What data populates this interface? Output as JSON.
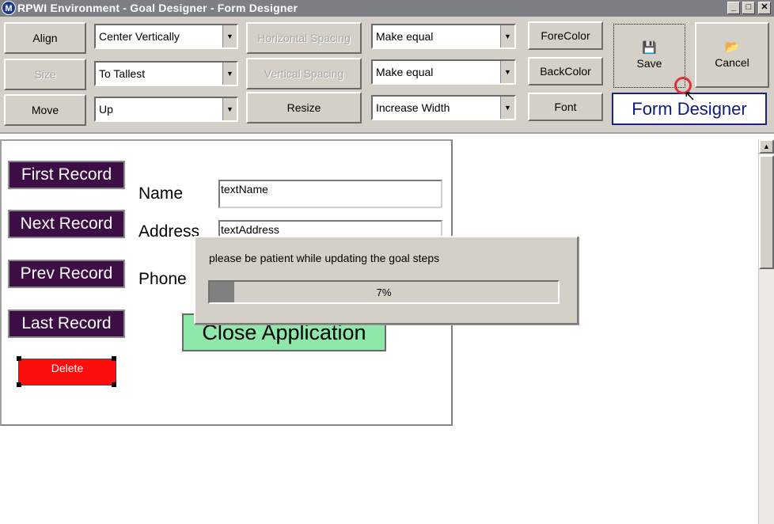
{
  "window": {
    "title": "RPWI Environment - Goal Designer - Form Designer",
    "logo_letter": "M",
    "minimize_glyph": "_",
    "maximize_glyph": "□",
    "close_glyph": "✕"
  },
  "toolbar": {
    "align_label": "Align",
    "align_value": "Center Vertically",
    "size_label": "Size",
    "size_value": "To Tallest",
    "move_label": "Move",
    "move_value": "Up",
    "hspacing_label": "Horizontal Spacing",
    "hspacing_value": "Make equal",
    "vspacing_label": "Vertical Spacing",
    "vspacing_value": "Make equal",
    "resize_label": "Resize",
    "resize_value": "Increase Width",
    "forecolor_label": "ForeColor",
    "backcolor_label": "BackColor",
    "font_label": "Font",
    "save_label": "Save",
    "cancel_label": "Cancel",
    "form_designer_label": "Form Designer",
    "dropdown_glyph": "▼"
  },
  "form": {
    "first_record": "First Record",
    "next_record": "Next Record",
    "prev_record": "Prev Record",
    "last_record": "Last Record",
    "delete": "Delete",
    "name_label": "Name",
    "address_label": "Address",
    "phone_label": "Phone",
    "name_field": "textName",
    "address_field": "textAddress",
    "close_app": "Close Application"
  },
  "progress": {
    "message": "please be patient while updating the goal steps",
    "percent_text": "7%",
    "fraction": 0.07
  },
  "colors": {
    "nav_button_bg": "#3d0d45",
    "close_button_bg": "#8ee8a9",
    "delete_button_bg": "#ff0e0e",
    "title_bar_bg": "#7d7f85",
    "form_designer_text": "#0d1b7a"
  },
  "icons": {
    "save": "floppy-disk-icon",
    "cancel": "folder-open-icon",
    "scroll_up": "▲"
  }
}
